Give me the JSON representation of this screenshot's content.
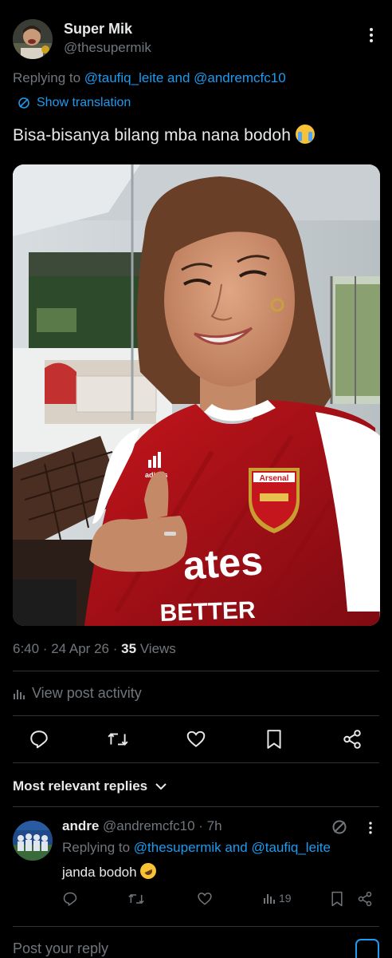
{
  "post": {
    "author_name": "Super Mik",
    "author_handle": "@thesupermik",
    "replying_prefix": "Replying to",
    "replying_user1": "@taufiq_leite",
    "replying_and": "and",
    "replying_user2": "@andremcfc10",
    "show_translation": "Show translation",
    "text": "Bisa-bisanya bilang mba nana bodoh",
    "time": "6:40 · 24 Apr 26 ·",
    "views_count": "35",
    "views_label": "Views",
    "view_activity": "View post activity"
  },
  "photo": {
    "jersey_sponsor_line1": "ates",
    "jersey_sponsor_line2": "BETTER",
    "jersey_badge_text": "Arsenal",
    "jersey_brand": "adidas"
  },
  "replies_header": "Most relevant replies",
  "reply": {
    "name": "andre",
    "handle": "@andremcfc10",
    "time": "· 7h",
    "replying_prefix": "Replying to",
    "replying_user1": "@thesupermik",
    "replying_and": "and",
    "replying_user2": "@taufiq_leite",
    "text": "janda bodoh",
    "views": "19"
  },
  "composer": {
    "placeholder": "Post your reply"
  },
  "colors": {
    "accent": "#1d9bf0",
    "muted": "#71767b",
    "background": "#000000",
    "text": "#e7e9ea"
  }
}
